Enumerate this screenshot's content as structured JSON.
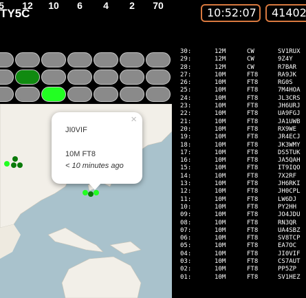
{
  "header": {
    "station": "TY5C",
    "clock_utc": "10:52:07",
    "clock_right": "41402"
  },
  "bands": {
    "labels": [
      "5",
      "12",
      "10",
      "6",
      "4",
      "2",
      "70"
    ],
    "status_rows": [
      [
        "grey",
        "grey",
        "grey",
        "grey",
        "grey",
        "grey",
        "grey"
      ],
      [
        "grey",
        "darkgreen",
        "grey",
        "grey",
        "grey",
        "grey",
        "grey"
      ],
      [
        "grey",
        "grey",
        "lime",
        "grey",
        "grey",
        "grey",
        "grey"
      ]
    ],
    "colors": {
      "grey": "#8a8a8a",
      "darkgreen": "#108a10",
      "lime": "#22ff22"
    }
  },
  "popup": {
    "close": "×",
    "callsign": "JI0VIF",
    "band_mode": "10M FT8",
    "age": "< 10 minutes ago"
  },
  "spots": [
    {
      "n": "30:",
      "band": "12M",
      "mode": "CW",
      "call": "SV1RUX"
    },
    {
      "n": "29:",
      "band": "12M",
      "mode": "CW",
      "call": "9Z4Y"
    },
    {
      "n": "28:",
      "band": "12M",
      "mode": "CW",
      "call": "R7BAR"
    },
    {
      "n": "27:",
      "band": "10M",
      "mode": "FT8",
      "call": "RA9JK"
    },
    {
      "n": "26:",
      "band": "10M",
      "mode": "FT8",
      "call": "RG0S"
    },
    {
      "n": "25:",
      "band": "10M",
      "mode": "FT8",
      "call": "7M4HOA"
    },
    {
      "n": "24:",
      "band": "10M",
      "mode": "FT8",
      "call": "JL3CRS"
    },
    {
      "n": "23:",
      "band": "10M",
      "mode": "FT8",
      "call": "JH6URJ"
    },
    {
      "n": "22:",
      "band": "10M",
      "mode": "FT8",
      "call": "UA9FGJ"
    },
    {
      "n": "21:",
      "band": "10M",
      "mode": "FT8",
      "call": "JA1UWB"
    },
    {
      "n": "20:",
      "band": "10M",
      "mode": "FT8",
      "call": "RX9WE"
    },
    {
      "n": "19:",
      "band": "10M",
      "mode": "FT8",
      "call": "JR4ECJ"
    },
    {
      "n": "18:",
      "band": "10M",
      "mode": "FT8",
      "call": "JK3WMY"
    },
    {
      "n": "17:",
      "band": "10M",
      "mode": "FT8",
      "call": "DS5TUK"
    },
    {
      "n": "16:",
      "band": "10M",
      "mode": "FT8",
      "call": "JA5QAH"
    },
    {
      "n": "15:",
      "band": "10M",
      "mode": "FT8",
      "call": "IT9IQO"
    },
    {
      "n": "14:",
      "band": "10M",
      "mode": "FT8",
      "call": "7X2RF"
    },
    {
      "n": "13:",
      "band": "10M",
      "mode": "FT8",
      "call": "JH6RKI"
    },
    {
      "n": "12:",
      "band": "10M",
      "mode": "FT8",
      "call": "JH0CPL"
    },
    {
      "n": "11:",
      "band": "10M",
      "mode": "FT8",
      "call": "LW6DJ"
    },
    {
      "n": "10:",
      "band": "10M",
      "mode": "FT8",
      "call": "PY2HH"
    },
    {
      "n": "09:",
      "band": "10M",
      "mode": "FT8",
      "call": "JO4JDU"
    },
    {
      "n": "08:",
      "band": "10M",
      "mode": "FT8",
      "call": "RN3QR"
    },
    {
      "n": "07:",
      "band": "10M",
      "mode": "FT8",
      "call": "UA4SBZ"
    },
    {
      "n": "06:",
      "band": "10M",
      "mode": "FT8",
      "call": "SV8TCP"
    },
    {
      "n": "05:",
      "band": "10M",
      "mode": "FT8",
      "call": "EA7OC"
    },
    {
      "n": "04:",
      "band": "10M",
      "mode": "FT8",
      "call": "JI0VIF"
    },
    {
      "n": "03:",
      "band": "10M",
      "mode": "FT8",
      "call": "CS7AUT"
    },
    {
      "n": "02:",
      "band": "10M",
      "mode": "FT8",
      "call": "PP5ZP"
    },
    {
      "n": "01:",
      "band": "10M",
      "mode": "FT8",
      "call": "SV1HEZ"
    }
  ]
}
